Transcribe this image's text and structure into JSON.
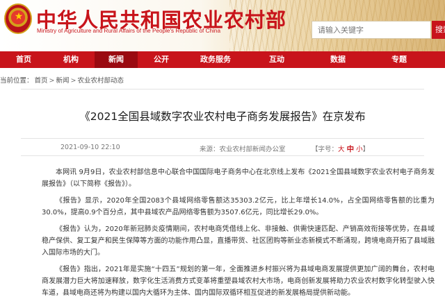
{
  "header": {
    "site_title": "中华人民共和国农业农村部",
    "site_subtitle": "Ministry of Agriculture and Rural Affairs of the People's Republic of China",
    "search_placeholder": "请输入关键字",
    "search_button": "搜索"
  },
  "nav": {
    "items": [
      {
        "label": "首页"
      },
      {
        "label": "机构"
      },
      {
        "label": "新闻"
      },
      {
        "label": "公开"
      },
      {
        "label": "政务服务"
      },
      {
        "label": "互动"
      },
      {
        "label": "数据"
      },
      {
        "label": "专题"
      }
    ],
    "active_index": 2
  },
  "breadcrumb": {
    "prefix": "当前位置：",
    "items": [
      "首页",
      "新闻",
      "农业农村部动态"
    ],
    "separator": ">"
  },
  "article": {
    "title": "《2021全国县域数字农业农村电子商务发展报告》在京发布",
    "date": "2021-09-10 22:10",
    "source_label": "来源：",
    "source": "农业农村部新闻办公室",
    "font_size_label": "【字号：",
    "font_large": "大",
    "font_medium": "中",
    "font_small": "小",
    "font_size_close": "】",
    "paragraphs": [
      "本网讯 9月9日，农业农村部信息中心联合中国国际电子商务中心在北京线上发布《2021全国县域数字农业农村电子商务发展报告》（以下简称《报告》）。",
      "《报告》显示，2020年全国2083个县域网络零售额达35303.2亿元，比上年增长14.0%，占全国网络零售额的比重为30.0%，提高0.9个百分点，其中县域农产品网络零售额为3507.6亿元，同比增长29.0%。",
      "《报告》认为，2020年新冠肺炎疫情期间，农村电商凭借线上化、非接触、供需快速匹配、产销高效衔接等优势，在县域稳产保供、复工复产和民生保障等方面的功能作用凸显，直播带货、社区团购等新业态新模式不断涌现，跨境电商开拓了县域融入国际市场的大门。",
      "《报告》指出，2021年是实施“十四五”规划的第一年，全面推进乡村振兴将为县域电商发展提供更加广阔的舞台，农村电商发展潜力巨大将加速释放，数字化生活消费方式变革将重塑县域农村大市场，电商创新发展将助力农业农村数字化转型驶入快车道，县域电商还将为构建以国内大循环为主体、国内国际双循环相互促进的新发展格局提供新动能。"
    ]
  }
}
